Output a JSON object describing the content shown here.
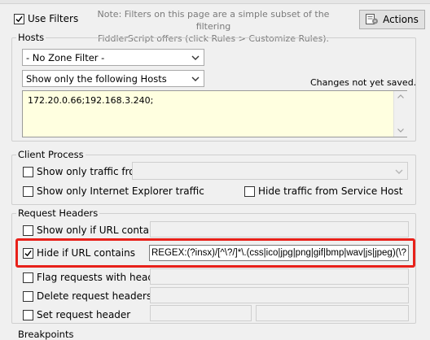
{
  "top": {
    "use_filters_label": "Use Filters",
    "use_filters_checked": true,
    "note": "Note: Filters on this page are a simple subset of the filtering FiddlerScript offers (click Rules > Customize Rules).",
    "note_line1": "Note: Filters on this page are a simple subset of the filtering",
    "note_line2": "FiddlerScript offers (click Rules > Customize Rules).",
    "actions_label": "Actions"
  },
  "hosts": {
    "legend": "Hosts",
    "zone_filter": "- No Zone Filter -",
    "host_filter": "Show only the following Hosts",
    "status": "Changes not yet saved.",
    "host_list": "172.20.0.66;192.168.3.240;"
  },
  "client_process": {
    "legend": "Client Process",
    "show_only_traffic_from": "Show only traffic from",
    "show_only_ie": "Show only Internet Explorer traffic",
    "hide_service_host": "Hide traffic from Service Host"
  },
  "request_headers": {
    "legend": "Request Headers",
    "show_only_if_url": "Show only if URL contains",
    "hide_if_url": "Hide if URL contains",
    "hide_if_url_checked": true,
    "hide_url_value": "REGEX:(?insx)/[^\\?/]*\\.(css|ico|jpg|png|gif|bmp|wav|js|jpeg)(\\?",
    "flag_requests": "Flag requests with headers",
    "delete_headers": "Delete request headers",
    "set_header": "Set request header"
  },
  "breakpoints": {
    "legend": "Breakpoints"
  },
  "colors": {
    "highlight": "#e8211a",
    "hosts_bg": "#ffffe0"
  }
}
